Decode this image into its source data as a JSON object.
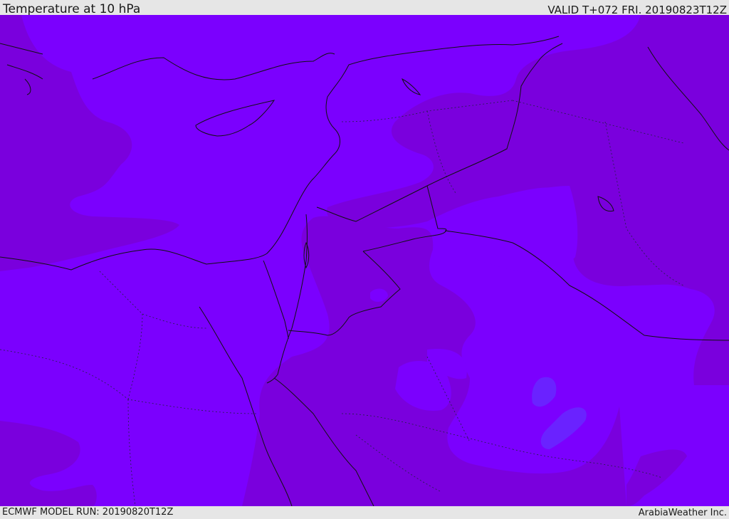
{
  "header": {
    "title": "Temperature at 10 hPa",
    "valid": "VALID T+072 FRI. 20190823T12Z"
  },
  "footer": {
    "model_run": "ECMWF MODEL RUN: 20190820T12Z",
    "credit": "ArabiaWeather Inc."
  },
  "colors": {
    "warm_field": "#7b00fe",
    "cool_field": "#7a00dd",
    "cold_spot": "#6a22ff",
    "coast": "#111111",
    "border": "#222244"
  }
}
